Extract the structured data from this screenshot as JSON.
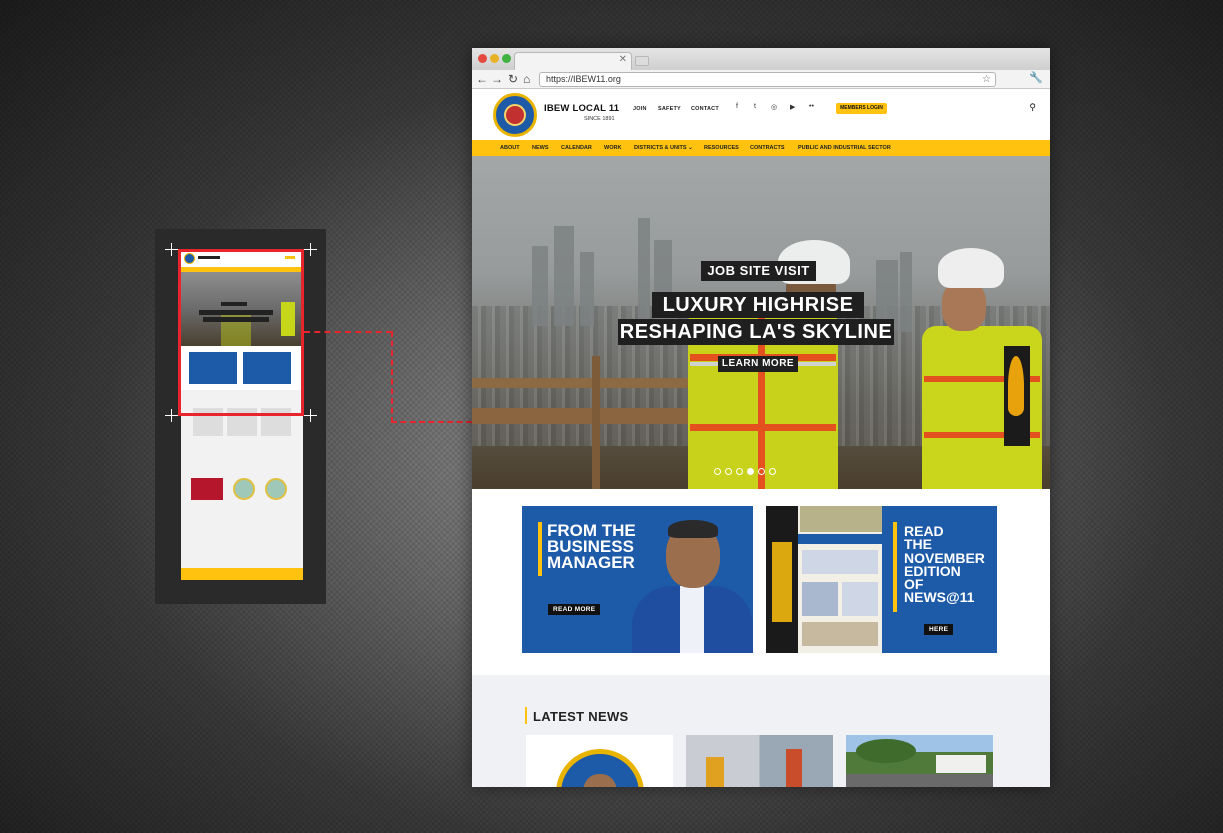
{
  "browser": {
    "url": "https://IBEW11.org",
    "controls": {
      "back": "←",
      "forward": "→",
      "reload": "↻",
      "home": "⌂",
      "bookmark": "☆",
      "menu": "🔧",
      "tab_close": "✕"
    }
  },
  "site": {
    "brand": "IBEW LOCAL 11",
    "since": "SINCE 1891",
    "top_links": [
      "JOIN",
      "SAFETY",
      "CONTACT"
    ],
    "social_icons": [
      "facebook-icon",
      "twitter-icon",
      "instagram-icon",
      "youtube-icon",
      "flickr-icon"
    ],
    "social_glyphs": [
      "f",
      "t",
      "◎",
      "▶",
      "••"
    ],
    "members_login": "MEMBERS LOGIN",
    "search_glyph": "⚲",
    "nav": [
      "ABOUT",
      "NEWS",
      "CALENDAR",
      "WORK",
      "DISTRICTS & UNITS ⌄",
      "RESOURCES",
      "CONTRACTS",
      "PUBLIC AND INDUSTRIAL SECTOR"
    ]
  },
  "hero": {
    "kicker": "JOB SITE VISIT",
    "headline_1": "LUXURY HIGHRISE",
    "headline_2": "RESHAPING LA'S SKYLINE",
    "cta": "LEARN MORE",
    "slides": 6,
    "active_slide": 4
  },
  "banners": {
    "manager": {
      "text": "FROM THE\nBUSINESS\nMANAGER",
      "button": "READ MORE"
    },
    "newsletter": {
      "text": "READ\nTHE\nNOVEMBER\nEDITION\nOF\nNEWS@11",
      "button": "HERE"
    }
  },
  "latest": {
    "title": "LATEST NEWS"
  },
  "colors": {
    "accent_yellow": "#ffc20e",
    "brand_blue": "#1d5aa8",
    "highlight_red": "#e8242c"
  }
}
